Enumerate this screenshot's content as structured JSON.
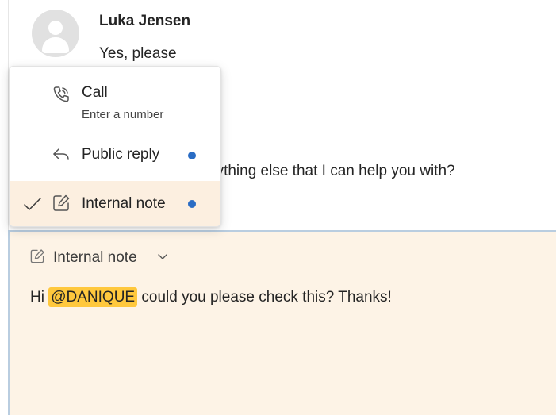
{
  "conversation": {
    "sender_name": "Luka Jensen",
    "message_text": "Yes, please",
    "agent_message_partial": "nything else that I can help you with?"
  },
  "reply_mode_menu": {
    "items": [
      {
        "label": "Call",
        "sublabel": "Enter a number",
        "icon": "phone-icon",
        "has_dot": false,
        "selected": false
      },
      {
        "label": "Public reply",
        "icon": "reply-arrow-icon",
        "has_dot": true,
        "selected": false
      },
      {
        "label": "Internal note",
        "icon": "note-edit-icon",
        "has_dot": true,
        "selected": true
      }
    ],
    "dot_color": "#2a6cc4",
    "selected_bg": "#fcefe0"
  },
  "composer": {
    "mode_label": "Internal note",
    "mode_icon": "note-edit-icon",
    "text_before": "Hi ",
    "mention": "@DANIQUE",
    "text_after": " could you please check this? Thanks!",
    "background": "#fdf3e6",
    "mention_highlight": "#ffc83d"
  }
}
